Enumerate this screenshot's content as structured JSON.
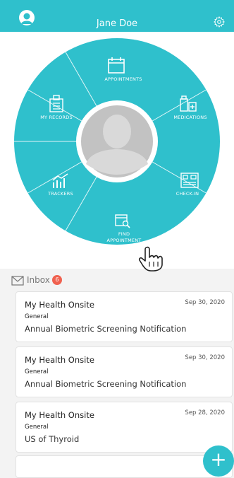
{
  "header": {
    "title": "Jane Doe"
  },
  "wheel": {
    "segments": {
      "appointments": "APPOINTMENTS",
      "medications": "MEDICATIONS",
      "check_in": "CHECK-IN",
      "find_appointment_line1": "FIND",
      "find_appointment_line2": "APPOINTMENT",
      "trackers": "TRACKERS",
      "my_records": "MY RECORDS"
    }
  },
  "inbox": {
    "label": "Inbox",
    "badge": "6",
    "messages": [
      {
        "sender": "My Health Onsite",
        "date": "Sep 30, 2020",
        "category": "General",
        "subject": "Annual Biometric Screening Notification"
      },
      {
        "sender": "My Health Onsite",
        "date": "Sep 30, 2020",
        "category": "General",
        "subject": "Annual Biometric Screening Notification"
      },
      {
        "sender": "My Health Onsite",
        "date": "Sep 28, 2020",
        "category": "General",
        "subject": "US of Thyroid"
      }
    ]
  },
  "fab": {
    "symbol": "+"
  },
  "colors": {
    "brand": "#2fc0cc",
    "badge": "#f0614f",
    "background": "#f3f3f3"
  },
  "icons": [
    "user-avatar-icon",
    "gear-icon",
    "calendar-icon",
    "medication-icon",
    "check-in-icon",
    "find-appointment-icon",
    "trackers-icon",
    "records-icon",
    "envelope-icon",
    "hand-cursor-icon"
  ]
}
